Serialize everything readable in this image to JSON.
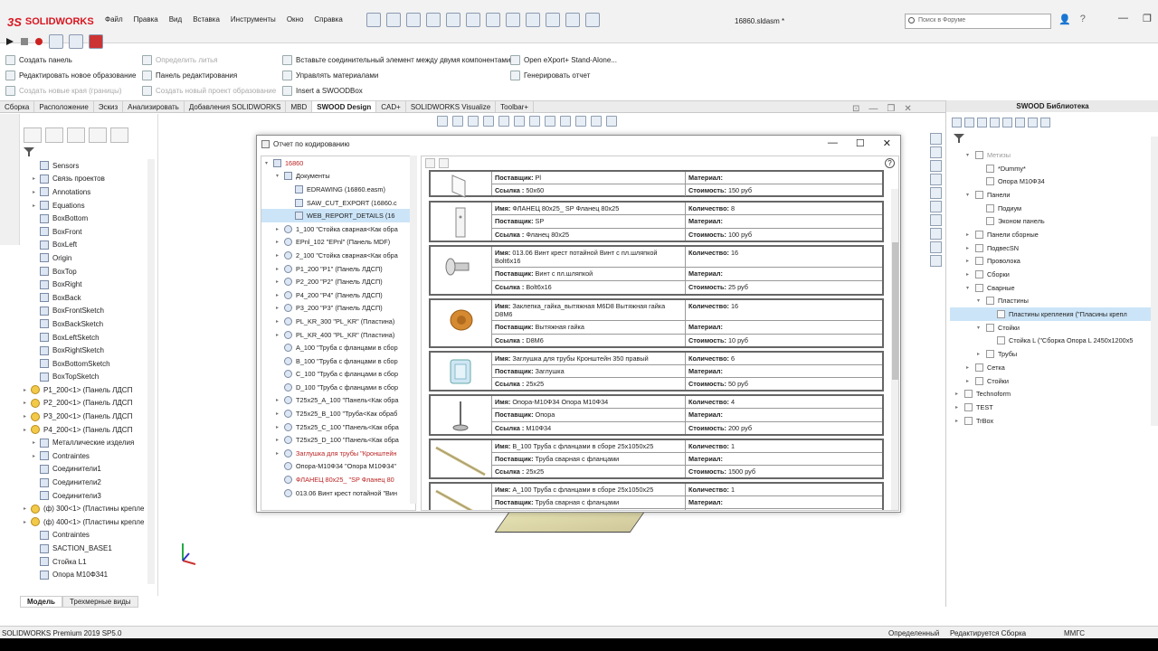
{
  "app": {
    "logo_ds": "3S",
    "logo_text": "SOLIDWORKS",
    "file_title": "16860.sldasm *",
    "search_placeholder": "Поиск в Форуме"
  },
  "menu": [
    "Файл",
    "Правка",
    "Вид",
    "Вставка",
    "Инструменты",
    "Окно",
    "Справка"
  ],
  "commands": {
    "create_panel": "Создать панель",
    "edit_new": "Редактировать новое образование",
    "create_edges": "Создать новые края (границы)",
    "define_casting": "Определить литья",
    "panel_edit": "Панель редактирования",
    "create_project": "Создать новый проект образование",
    "insert_connector": "Вставьте соединительный элемент между двумя компонентами",
    "manage_materials": "Управлять материалами",
    "insert_swoodbox": "Insert a SWOODBox",
    "open_export": "Open eXport+ Stand-Alone...",
    "generate_report": "Генерировать отчет"
  },
  "tabs": [
    "Сборка",
    "Расположение",
    "Эскиз",
    "Анализировать",
    "Добавления SOLIDWORKS",
    "MBD",
    "SWOOD Design",
    "CAD+",
    "SOLIDWORKS Visualize",
    "Toolbar+"
  ],
  "active_tab": "SWOOD Design",
  "feature_tree": [
    {
      "t": "Sensors",
      "tog": ""
    },
    {
      "t": "Связь проектов",
      "tog": "▸"
    },
    {
      "t": "Annotations",
      "tog": "▸"
    },
    {
      "t": "Equations",
      "tog": "▸"
    },
    {
      "t": "BoxBottom",
      "tog": ""
    },
    {
      "t": "BoxFront",
      "tog": ""
    },
    {
      "t": "BoxLeft",
      "tog": ""
    },
    {
      "t": "Origin",
      "tog": ""
    },
    {
      "t": "BoxTop",
      "tog": ""
    },
    {
      "t": "BoxRight",
      "tog": ""
    },
    {
      "t": "BoxBack",
      "tog": ""
    },
    {
      "t": "BoxFrontSketch",
      "tog": ""
    },
    {
      "t": "BoxBackSketch",
      "tog": ""
    },
    {
      "t": "BoxLeftSketch",
      "tog": ""
    },
    {
      "t": "BoxRightSketch",
      "tog": ""
    },
    {
      "t": "BoxBottomSketch",
      "tog": ""
    },
    {
      "t": "BoxTopSketch",
      "tog": ""
    },
    {
      "t": "P1_200<1> (Панель ЛДСП",
      "tog": "▸",
      "y": 1
    },
    {
      "t": "P2_200<1> (Панель ЛДСП",
      "tog": "▸",
      "y": 1
    },
    {
      "t": "P3_200<1> (Панель ЛДСП",
      "tog": "▸",
      "y": 1
    },
    {
      "t": "P4_200<1> (Панель ЛДСП",
      "tog": "▸",
      "y": 1
    },
    {
      "t": "Металлические изделия",
      "tog": "▸"
    },
    {
      "t": "Contraintes",
      "tog": "▸"
    },
    {
      "t": "Соединители1",
      "tog": ""
    },
    {
      "t": "Соединители2",
      "tog": ""
    },
    {
      "t": "Соединители3",
      "tog": ""
    },
    {
      "t": "(ф) 300<1> (Пластины крепле",
      "tog": "▸",
      "y": 1
    },
    {
      "t": "(ф) 400<1> (Пластины крепле",
      "tog": "▸",
      "y": 1
    },
    {
      "t": "Contraintes",
      "tog": ""
    },
    {
      "t": "SACTION_BASE1",
      "tog": ""
    },
    {
      "t": "Стойка L1",
      "tog": ""
    },
    {
      "t": "Опора М10Ф341",
      "tog": ""
    }
  ],
  "bottom_tabs": [
    "Модель",
    "Трехмерные виды"
  ],
  "status": {
    "product": "SOLIDWORKS Premium 2019 SP5.0",
    "defined": "Определенный",
    "editing": "Редактируется Сборка",
    "units": "ММГС"
  },
  "dialog": {
    "title": "Отчет по кодированию"
  },
  "report_tree": [
    {
      "t": "16860",
      "tog": "▾",
      "d": 0,
      "c": "red"
    },
    {
      "t": "Документы",
      "tog": "▾",
      "d": 1
    },
    {
      "t": "EDRAWING (16860.easm)",
      "tog": "",
      "d": 2
    },
    {
      "t": "SAW_CUT_EXPORT (16860.c",
      "tog": "",
      "d": 2
    },
    {
      "t": "WEB_REPORT_DETAILS (16",
      "tog": "",
      "d": 2,
      "sel": 1
    },
    {
      "t": "1_100 \"Стойка сварная<Как обра",
      "tog": "▸",
      "d": 1,
      "y": 1
    },
    {
      "t": "EPnl_102 \"EPnl\" (Панель MDF)",
      "tog": "▸",
      "d": 1,
      "y": 1
    },
    {
      "t": "2_100 \"Стойка сварная<Как обра",
      "tog": "▸",
      "d": 1,
      "y": 1
    },
    {
      "t": "P1_200 \"P1\" (Панель ЛДСП)",
      "tog": "▸",
      "d": 1,
      "y": 1
    },
    {
      "t": "P2_200 \"P2\" (Панель ЛДСП)",
      "tog": "▸",
      "d": 1,
      "y": 1
    },
    {
      "t": "P4_200 \"P4\" (Панель ЛДСП)",
      "tog": "▸",
      "d": 1,
      "y": 1
    },
    {
      "t": "P3_200 \"P3\" (Панель ЛДСП)",
      "tog": "▸",
      "d": 1,
      "y": 1
    },
    {
      "t": "PL_KR_300 \"PL_KR\" (Пластина)",
      "tog": "▸",
      "d": 1,
      "y": 1
    },
    {
      "t": "PL_KR_400 \"PL_KR\" (Пластина)",
      "tog": "▸",
      "d": 1,
      "y": 1
    },
    {
      "t": "A_100 \"Труба с фланцами в сбор",
      "tog": "",
      "d": 1,
      "y": 1
    },
    {
      "t": "B_100 \"Труба с фланцами в сбор",
      "tog": "",
      "d": 1,
      "y": 1
    },
    {
      "t": "C_100 \"Труба с фланцами в сбор",
      "tog": "",
      "d": 1,
      "y": 1
    },
    {
      "t": "D_100 \"Труба с фланцами в сбор",
      "tog": "",
      "d": 1,
      "y": 1
    },
    {
      "t": "T25x25_A_100 \"Панель<Как обра",
      "tog": "▸",
      "d": 1,
      "y": 1
    },
    {
      "t": "T25x25_B_100 \"Труба<Как обраб",
      "tog": "▸",
      "d": 1,
      "y": 1
    },
    {
      "t": "T25x25_C_100 \"Панель<Как обра",
      "tog": "▸",
      "d": 1,
      "y": 1
    },
    {
      "t": "T25x25_D_100 \"Панель<Как обра",
      "tog": "▸",
      "d": 1,
      "y": 1
    },
    {
      "t": "Заглушка для трубы \"Кронштейн",
      "tog": "▸",
      "d": 1,
      "y": 1,
      "c": "red"
    },
    {
      "t": "Опора-M10Ф34 \"Опора M10Ф34\"",
      "tog": "",
      "d": 1,
      "y": 1
    },
    {
      "t": "ФЛАНЕЦ 80x25_ \"SP Фланец 80",
      "tog": "",
      "d": 1,
      "y": 1,
      "c": "red"
    },
    {
      "t": "013.06 Винт крест потайной \"Вин",
      "tog": "",
      "d": 1,
      "y": 1
    }
  ],
  "labels": {
    "name": "Имя:",
    "supplier": "Поставщик:",
    "link": "Ссылка :",
    "material": "Материал:",
    "qty": "Количество:",
    "cost": "Стоимость:"
  },
  "report_entries": [
    {
      "name": "",
      "supplier": "Pl",
      "link": "50x60",
      "qty": "",
      "material": "",
      "cost": "150 руб",
      "top": true,
      "thumb": "plate"
    },
    {
      "name": "ФЛАНЕЦ 80x25_ SP Фланец 80x25",
      "supplier": "SP",
      "link": "Фланец 80x25",
      "qty": "8",
      "material": "",
      "cost": "100 руб",
      "thumb": "flange"
    },
    {
      "name": "013.06 Винт крест потайной Винт с пл.шляпкой Bolt6x16",
      "supplier": "Винт с пл.шляпкой",
      "link": "Bolt6x16",
      "qty": "16",
      "material": "",
      "cost": "25 руб",
      "thumb": "bolt"
    },
    {
      "name": "Заклепка_гайка_вытяжная M6D8 Вытяжная гайка D8M6",
      "supplier": "Вытяжная гайка",
      "link": "D8M6",
      "qty": "16",
      "material": "",
      "cost": "10 руб",
      "thumb": "nut"
    },
    {
      "name": "Заглушка для трубы Кронштейн 350 правый",
      "supplier": "Заглушка",
      "link": "25x25",
      "qty": "6",
      "material": "",
      "cost": "50 руб",
      "thumb": "cap"
    },
    {
      "name": "Опора-M10Ф34 Опора M10Ф34",
      "supplier": "Опора",
      "link": "M10Ф34",
      "qty": "4",
      "material": "",
      "cost": "200 руб",
      "thumb": "foot"
    },
    {
      "name": "B_100 Труба с фланцами в сборе 25x1050x25",
      "supplier": "Труба сварная с фланцами",
      "link": "25x25",
      "qty": "1",
      "material": "",
      "cost": "1500 руб",
      "thumb": "tube"
    },
    {
      "name": "A_100 Труба с фланцами в сборе 25x1050x25",
      "supplier": "Труба сварная с фланцами",
      "link": "",
      "qty": "1",
      "material": "",
      "cost": "",
      "thumb": "tube",
      "cut": true
    }
  ],
  "library": {
    "title": "SWOOD Библиотека",
    "items": [
      {
        "t": "Метизы",
        "d": 1,
        "tog": "▾",
        "g": 1
      },
      {
        "t": "*Dummy*",
        "d": 2,
        "tog": ""
      },
      {
        "t": "Опора M10Ф34",
        "d": 2,
        "tog": ""
      },
      {
        "t": "Панели",
        "d": 1,
        "tog": "▾"
      },
      {
        "t": "Подиум",
        "d": 2,
        "tog": ""
      },
      {
        "t": "Эконом панель",
        "d": 2,
        "tog": ""
      },
      {
        "t": "Панели сборные",
        "d": 1,
        "tog": "▸"
      },
      {
        "t": "ПодвесSN",
        "d": 1,
        "tog": "▸"
      },
      {
        "t": "Проволока",
        "d": 1,
        "tog": "▸"
      },
      {
        "t": "Сборки",
        "d": 1,
        "tog": "▸"
      },
      {
        "t": "Сварные",
        "d": 1,
        "tog": "▾"
      },
      {
        "t": "Пластины",
        "d": 2,
        "tog": "▾"
      },
      {
        "t": "Пластины крепления (\"Пласины крепл",
        "d": 3,
        "tog": "",
        "sel": 1
      },
      {
        "t": "Стойки",
        "d": 2,
        "tog": "▾"
      },
      {
        "t": "Стойка L (\"Сборка Опора L 2450x1200x5",
        "d": 3,
        "tog": ""
      },
      {
        "t": "Трубы",
        "d": 2,
        "tog": "▸"
      },
      {
        "t": "Сетка",
        "d": 1,
        "tog": "▸"
      },
      {
        "t": "Стойки",
        "d": 1,
        "tog": "▸"
      },
      {
        "t": "Technoform",
        "d": 0,
        "tog": "▸"
      },
      {
        "t": "TEST",
        "d": 0,
        "tog": "▸"
      },
      {
        "t": "TrBox",
        "d": 0,
        "tog": "▸"
      }
    ]
  }
}
